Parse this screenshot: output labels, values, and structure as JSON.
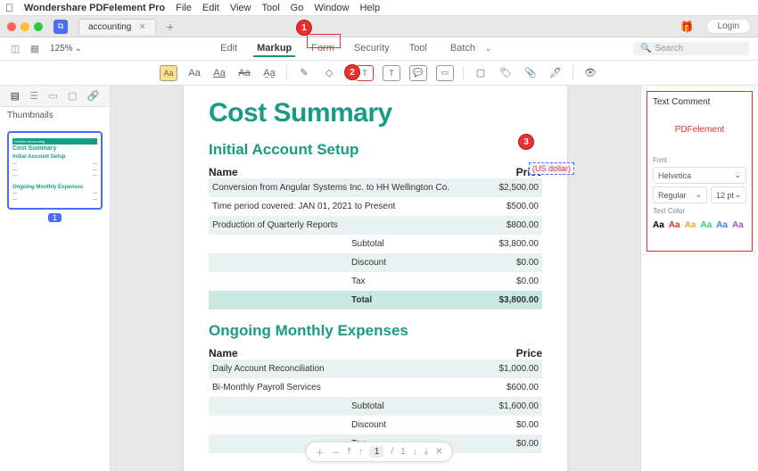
{
  "app": {
    "name": "Wondershare PDFelement Pro"
  },
  "menu": [
    "File",
    "Edit",
    "View",
    "Tool",
    "Go",
    "Window",
    "Help"
  ],
  "titlebar": {
    "tab": "accounting",
    "login": "Login"
  },
  "topnav": {
    "zoom": "125%",
    "tabs": [
      "Edit",
      "Markup",
      "Form",
      "Security",
      "Tool",
      "Batch"
    ],
    "active_idx": 1,
    "search_placeholder": "Search"
  },
  "sidebar": {
    "label": "Thumbnails",
    "thumb_num": "1"
  },
  "doc": {
    "h1": "Cost Summary",
    "section1": {
      "title": "Initial Account Setup",
      "col_name": "Name",
      "col_price": "Price",
      "annot": "(US dollar)",
      "rows": [
        {
          "name": "Conversion from Angular Systems Inc. to HH Wellington Co.",
          "price": "$2,500.00"
        },
        {
          "name": "Time period covered: JAN 01, 2021 to Present",
          "price": "$500.00"
        },
        {
          "name": "Production of Quarterly Reports",
          "price": "$800.00"
        }
      ],
      "subtotal_l": "Subtotal",
      "subtotal_v": "$3,800.00",
      "discount_l": "Discount",
      "discount_v": "$0.00",
      "tax_l": "Tax",
      "tax_v": "$0.00",
      "total_l": "Total",
      "total_v": "$3,800.00"
    },
    "section2": {
      "title": "Ongoing Monthly Expenses",
      "col_name": "Name",
      "col_price": "Price",
      "rows": [
        {
          "name": "Daily Account Reconciliation",
          "price": "$1,000.00"
        },
        {
          "name": "Bi-Monthly Payroll Services",
          "price": "$600.00"
        }
      ],
      "subtotal_l": "Subtotal",
      "subtotal_v": "$1,600.00",
      "discount_l": "Discount",
      "discount_v": "$0.00",
      "tax_l": "Tax",
      "tax_v": "$0.00"
    }
  },
  "rpanel": {
    "title": "Text Comment",
    "preview": "PDFelement",
    "font_lbl": "Font",
    "font_val": "Helvetica",
    "weight_val": "Regular",
    "size_val": "12 pt",
    "tc_lbl": "Text Color",
    "aa": "Aa"
  },
  "pager": {
    "page": "1",
    "total": "1",
    "sep": "/"
  },
  "badges": {
    "b1": "1",
    "b2": "2",
    "b3": "3"
  },
  "thumb": {
    "brand": "Deloitte Accounting",
    "h1": "Cost Summary",
    "s1": "Initial Account Setup",
    "s2": "Ongoing Monthly Expenses"
  }
}
